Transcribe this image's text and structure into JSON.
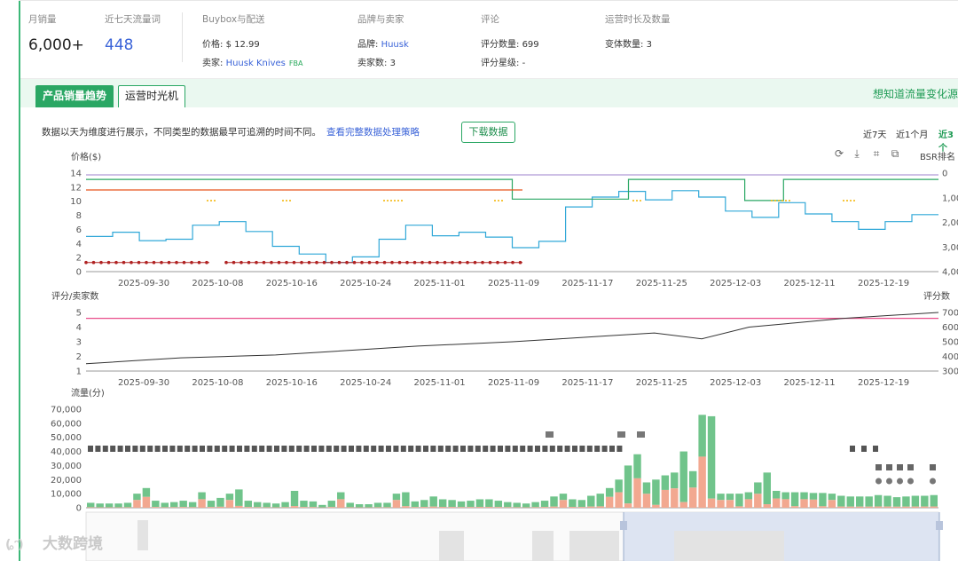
{
  "summary": {
    "monthly_sales": {
      "label": "月销量",
      "value": "6,000+"
    },
    "traffic_words": {
      "label": "近七天流量词",
      "value": "448"
    },
    "buybox": {
      "label": "Buybox与配送",
      "price_label": "价格:",
      "price": "$ 12.99",
      "seller_label": "卖家:",
      "seller": "Huusk Knives",
      "fba": "FBA"
    },
    "brand": {
      "label": "品牌与卖家",
      "brand_label": "品牌:",
      "brand": "Huusk",
      "sellers_label": "卖家数:",
      "sellers": "3"
    },
    "reviews": {
      "label": "评论",
      "count_label": "评分数量:",
      "count": "699",
      "stars_label": "评分星级:",
      "stars": "-"
    },
    "age": {
      "label": "运营时长及数量",
      "variants_label": "变体数量:",
      "variants": "3"
    }
  },
  "tabs": {
    "sales_trend": "产品销量趋势",
    "time_machine": "运营时光机",
    "promo": "想知道流量变化源"
  },
  "desc": {
    "text": "数据以天为维度进行展示，不同类型的数据最早可追溯的时间不同。",
    "link": "查看完整数据处理策略",
    "download": "下载数据"
  },
  "ranges": {
    "r7": "近7天",
    "r30": "近1个月",
    "r90": "近3个"
  },
  "tools": {
    "refresh": "⟳",
    "download": "⤓",
    "crop": "⌗",
    "copy": "⧉"
  },
  "colors": {
    "accent": "#2aa764",
    "price": "#31a8d8",
    "bsr": "#2aa764",
    "buybox": "#e8541e",
    "coupon": "#f4b400",
    "review_line": "#333333",
    "star_line": "#e94d8a",
    "bar_green": "#70c48b",
    "bar_pink": "#f2a890"
  },
  "chart_data": [
    {
      "type": "line",
      "ylabel": "价格($)",
      "y2label": "BSR排名",
      "ylim": [
        0,
        14
      ],
      "yticks": [
        "14",
        "12",
        "10",
        "8",
        "6",
        "4",
        "2",
        "0"
      ],
      "y2ticks": [
        "0",
        "1,00",
        "2,00",
        "3,00",
        "4,00"
      ],
      "x": [
        "2025-09-30",
        "2025-10-08",
        "2025-10-16",
        "2025-10-24",
        "2025-11-01",
        "2025-11-09",
        "2025-11-17",
        "2025-11-25",
        "2025-12-03",
        "2025-12-11",
        "2025-12-19"
      ],
      "series": [
        {
          "name": "price",
          "values": [
            5.0,
            5.6,
            4.4,
            4.6,
            6.6,
            7.1,
            5.7,
            3.6,
            2.5,
            1.3,
            2.1,
            4.6,
            6.6,
            5.1,
            5.6,
            4.9,
            3.4,
            4.3,
            9.2,
            10.6,
            11.4,
            10.2,
            11.5,
            10.6,
            8.6,
            7.7,
            9.8,
            8.2,
            7.1,
            6.0,
            7.1,
            8.1
          ]
        },
        {
          "name": "bsr",
          "values": [
            13.1,
            13.1,
            13.1,
            13.1,
            13.1,
            13.1,
            13.1,
            13.1,
            13.1,
            13.1,
            13.1,
            10.3,
            10.3,
            10.3,
            13.1,
            13.1,
            13.1,
            10.1,
            13.1,
            13.1,
            13.1,
            13.1
          ]
        },
        {
          "name": "buybox",
          "values": [
            11.6,
            11.6,
            11.6,
            11.6,
            11.6,
            11.6,
            11.6,
            11.6,
            11.6
          ]
        },
        {
          "name": "lowest",
          "values": [
            1.3,
            1.3,
            1.3,
            1.3,
            1.3,
            1.3,
            1.3,
            1.3
          ]
        }
      ]
    },
    {
      "type": "line",
      "ylabel": "评分/卖家数",
      "y2label": "评分数",
      "ylim": [
        1,
        5
      ],
      "yticks": [
        "5",
        "4",
        "3",
        "2",
        "1"
      ],
      "y2ticks": [
        "700",
        "600",
        "500",
        "400",
        "300"
      ],
      "series": [
        {
          "name": "review_count",
          "values": [
            1.5,
            1.7,
            1.9,
            2.0,
            2.1,
            2.3,
            2.5,
            2.7,
            2.85,
            3.0,
            3.2,
            3.4,
            3.6,
            3.2,
            4.0,
            4.3,
            4.6,
            4.8,
            5.0
          ]
        },
        {
          "name": "sellers",
          "values": [
            4.6,
            4.6,
            4.6,
            4.6,
            4.6
          ]
        }
      ]
    },
    {
      "type": "bar",
      "ylabel": "流量(分)",
      "ylim": [
        0,
        70000
      ],
      "yticks": [
        "70,000",
        "60,000",
        "50,000",
        "40,000",
        "30,000",
        "20,000",
        "10,000",
        "0"
      ],
      "values": [
        3500,
        3000,
        3000,
        3000,
        3500,
        10000,
        14000,
        5000,
        3500,
        4000,
        5000,
        4000,
        11000,
        5000,
        7000,
        10000,
        13000,
        5000,
        4000,
        3500,
        3000,
        4000,
        12000,
        5000,
        4500,
        2000,
        5000,
        11000,
        3500,
        2500,
        2500,
        3500,
        3500,
        10000,
        11000,
        4500,
        5500,
        8000,
        6000,
        5500,
        4500,
        5000,
        6000,
        6000,
        5000,
        4000,
        3500,
        3000,
        4000,
        5000,
        8000,
        10000,
        6000,
        5500,
        8500,
        10000,
        14000,
        20000,
        30000,
        38000,
        18000,
        20000,
        23000,
        25000,
        40000,
        26000,
        66000,
        65000,
        10000,
        10000,
        10000,
        11000,
        18000,
        25000,
        12000,
        11000,
        11000,
        11000,
        10500,
        10500,
        10000,
        8500,
        8000,
        8000,
        8000,
        9000,
        8500,
        7500,
        8000,
        8500,
        8500,
        9000
      ]
    }
  ],
  "watermark": "大数跨境"
}
